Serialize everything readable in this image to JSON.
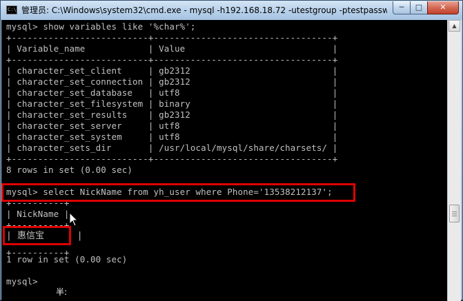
{
  "window": {
    "title": "管理员: C:\\Windows\\system32\\cmd.exe - mysql  -h192.168.18.72 -utestgroup -ptestpasswo...",
    "icon_label": "C:\\",
    "controls": {
      "minimize": "─",
      "maximize": "□",
      "close": "✕"
    }
  },
  "console": {
    "lines": [
      "mysql> show variables like '%char%';",
      "+--------------------------+----------------------------------+",
      "| Variable_name            | Value                            |",
      "+--------------------------+----------------------------------+",
      "| character_set_client     | gb2312                           |",
      "| character_set_connection | gb2312                           |",
      "| character_set_database   | utf8                             |",
      "| character_set_filesystem | binary                           |",
      "| character_set_results    | gb2312                           |",
      "| character_set_server     | utf8                             |",
      "| character_set_system     | utf8                             |",
      "| character_sets_dir       | /usr/local/mysql/share/charsets/ |",
      "+--------------------------+----------------------------------+",
      "8 rows in set (0.00 sec)",
      "",
      "mysql> select NickName from yh_user where Phone='13538212137';",
      "+----------+",
      "| NickName |",
      "+----------+",
      "| 惠信宝      |",
      "+----------+",
      "1 row in set (0.00 sec)",
      "",
      "mysql>"
    ]
  },
  "ime_indicator": "半:",
  "scrollbar": {
    "up_arrow": "▲"
  }
}
